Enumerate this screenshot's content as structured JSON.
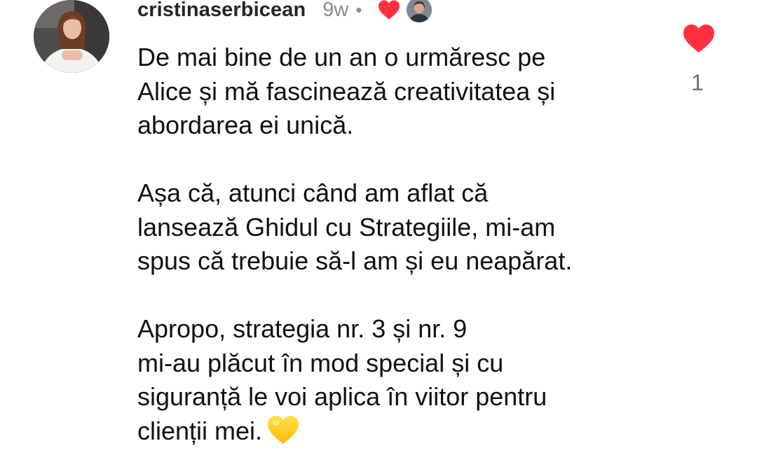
{
  "comment": {
    "author": "cristinaserbicean",
    "timestamp": "9w",
    "separator": "•",
    "lines": [
      "De mai bine de un an o urmăresc pe",
      "Alice și mă fascinează creativitatea și",
      "abordarea ei unică.",
      "",
      "Așa că, atunci când am aflat că",
      "lansează Ghidul cu Strategiile, mi-am",
      "spus că trebuie să-l am și eu neapărat.",
      "",
      "Apropo, strategia nr. 3 și nr. 9",
      "mi-au plăcut în mod special și cu",
      "siguranță le voi aplica în viitor pentru",
      "clienții mei."
    ],
    "trailing_emoji": "yellow-heart-emoji",
    "liked_by_creator": true,
    "like_count": "1"
  },
  "icons": {
    "creator_heart": "heart-icon",
    "like_button": "heart-icon",
    "emoji": "yellow-heart-icon"
  },
  "colors": {
    "heart_red": "#ff3040",
    "text": "#111111",
    "muted": "#8e8e8e",
    "count": "#737373",
    "emoji_yellow": "#ffcc1f"
  }
}
